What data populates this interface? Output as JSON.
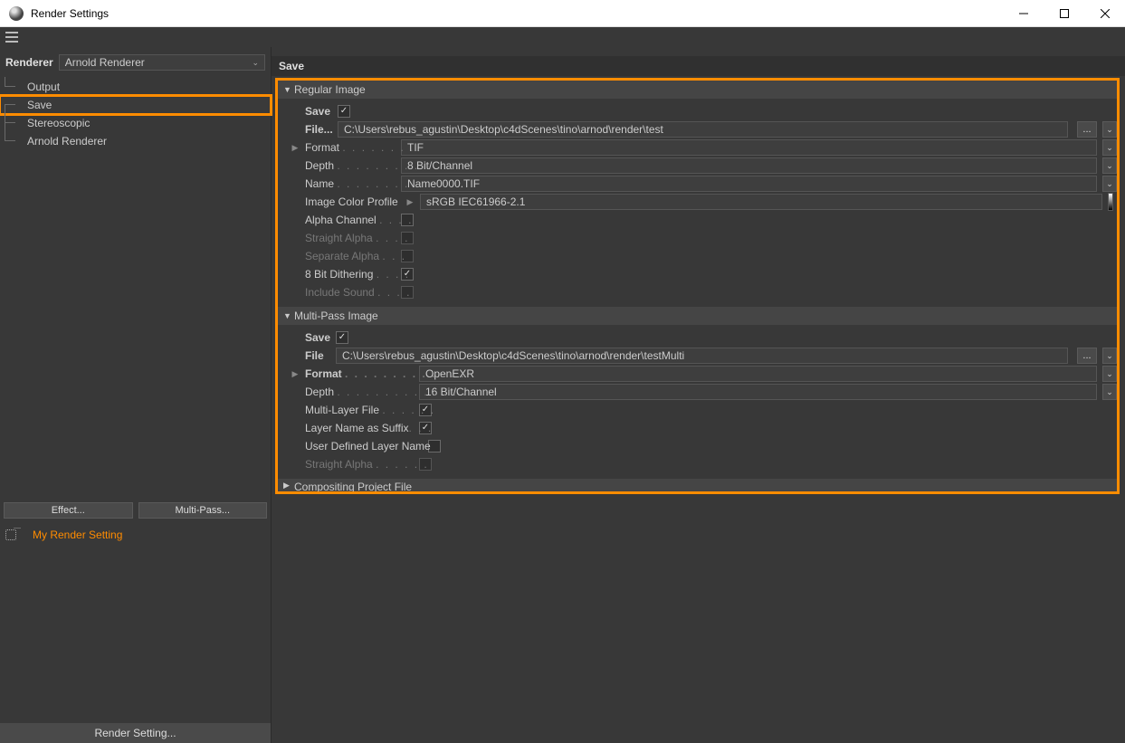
{
  "window": {
    "title": "Render Settings"
  },
  "sidebar": {
    "renderer_label": "Renderer",
    "renderer_value": "Arnold Renderer",
    "tree": {
      "output": "Output",
      "save": "Save",
      "stereoscopic": "Stereoscopic",
      "arnold": "Arnold Renderer"
    },
    "effect_btn": "Effect...",
    "multipass_btn": "Multi-Pass...",
    "my_setting": "My Render Setting",
    "bottom": "Render Setting..."
  },
  "content": {
    "tab": "Save",
    "regular": {
      "header": "Regular Image",
      "save_label": "Save",
      "save_checked": true,
      "file_label": "File...",
      "file_value": "C:\\Users\\rebus_agustin\\Desktop\\c4dScenes\\tino\\arnod\\render\\test",
      "format_label": "Format",
      "format_value": "TIF",
      "depth_label": "Depth",
      "depth_value": "8 Bit/Channel",
      "name_label": "Name",
      "name_value": "Name0000.TIF",
      "icp_label": "Image Color Profile",
      "icp_value": "sRGB IEC61966-2.1",
      "alpha_label": "Alpha Channel",
      "straight_label": "Straight Alpha",
      "separate_label": "Separate Alpha",
      "dither_label": "8 Bit Dithering",
      "sound_label": "Include Sound"
    },
    "multi": {
      "header": "Multi-Pass Image",
      "save_label": "Save",
      "file_label": "File",
      "file_value": "C:\\Users\\rebus_agustin\\Desktop\\c4dScenes\\tino\\arnod\\render\\testMulti",
      "format_label": "Format",
      "format_value": "OpenEXR",
      "depth_label": "Depth",
      "depth_value": "16 Bit/Channel",
      "mlf_label": "Multi-Layer File",
      "lns_label": "Layer Name as Suffix",
      "udln_label": "User Defined Layer Name",
      "straight_label": "Straight Alpha"
    },
    "comp": {
      "header": "Compositing Project File"
    }
  }
}
